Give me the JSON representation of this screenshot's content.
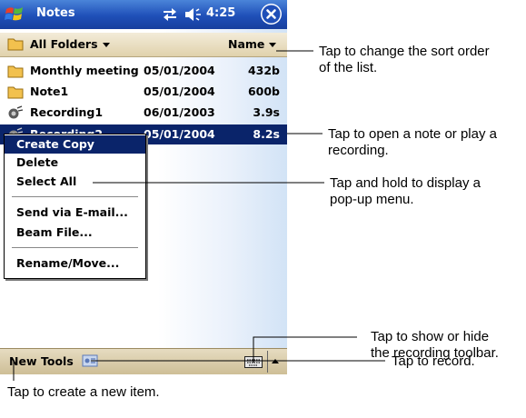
{
  "titlebar": {
    "start_icon": "windows-flag-icon",
    "app_title": "Notes",
    "sync_icon": "sync-arrows-icon",
    "volume_icon": "speaker-icon",
    "time": "4:25",
    "close_icon": "close-icon"
  },
  "folder_bar": {
    "folder_label": "All Folders",
    "sort_label": "Name"
  },
  "files": [
    {
      "icon": "note-folder-icon",
      "name": "Monthly meeting",
      "date": "05/01/2004",
      "size": "432b"
    },
    {
      "icon": "note-folder-icon",
      "name": "Note1",
      "date": "05/01/2004",
      "size": "600b"
    },
    {
      "icon": "recording-icon",
      "name": "Recording1",
      "date": "06/01/2003",
      "size": "3.9s"
    },
    {
      "icon": "recording-icon",
      "name": "Recording2",
      "date": "05/01/2004",
      "size": "8.2s"
    }
  ],
  "context_menu": {
    "items": [
      "Create Copy",
      "Delete",
      "Select All",
      "Send via E-mail...",
      "Beam File...",
      "Rename/Move..."
    ]
  },
  "bottom_bar": {
    "new_label": "New",
    "tools_label": "Tools",
    "record_icon": "record-toolbar-icon",
    "keyboard_icon": "keyboard-icon",
    "input_arrow_icon": "input-arrow-icon"
  },
  "callouts": {
    "sort": "Tap to change the sort order\nof the list.",
    "open": "Tap to open a note or play a\nrecording.",
    "hold": "Tap and hold to display a\npop-up menu.",
    "toolbar": "Tap to show or hide\nthe recording toolbar.",
    "record": "Tap to record.",
    "new_item": "Tap to create a new item."
  },
  "colors": {
    "title_bar": "#1f4fb8",
    "selection": "#0a246a",
    "command_bar": "#d9cba7"
  }
}
